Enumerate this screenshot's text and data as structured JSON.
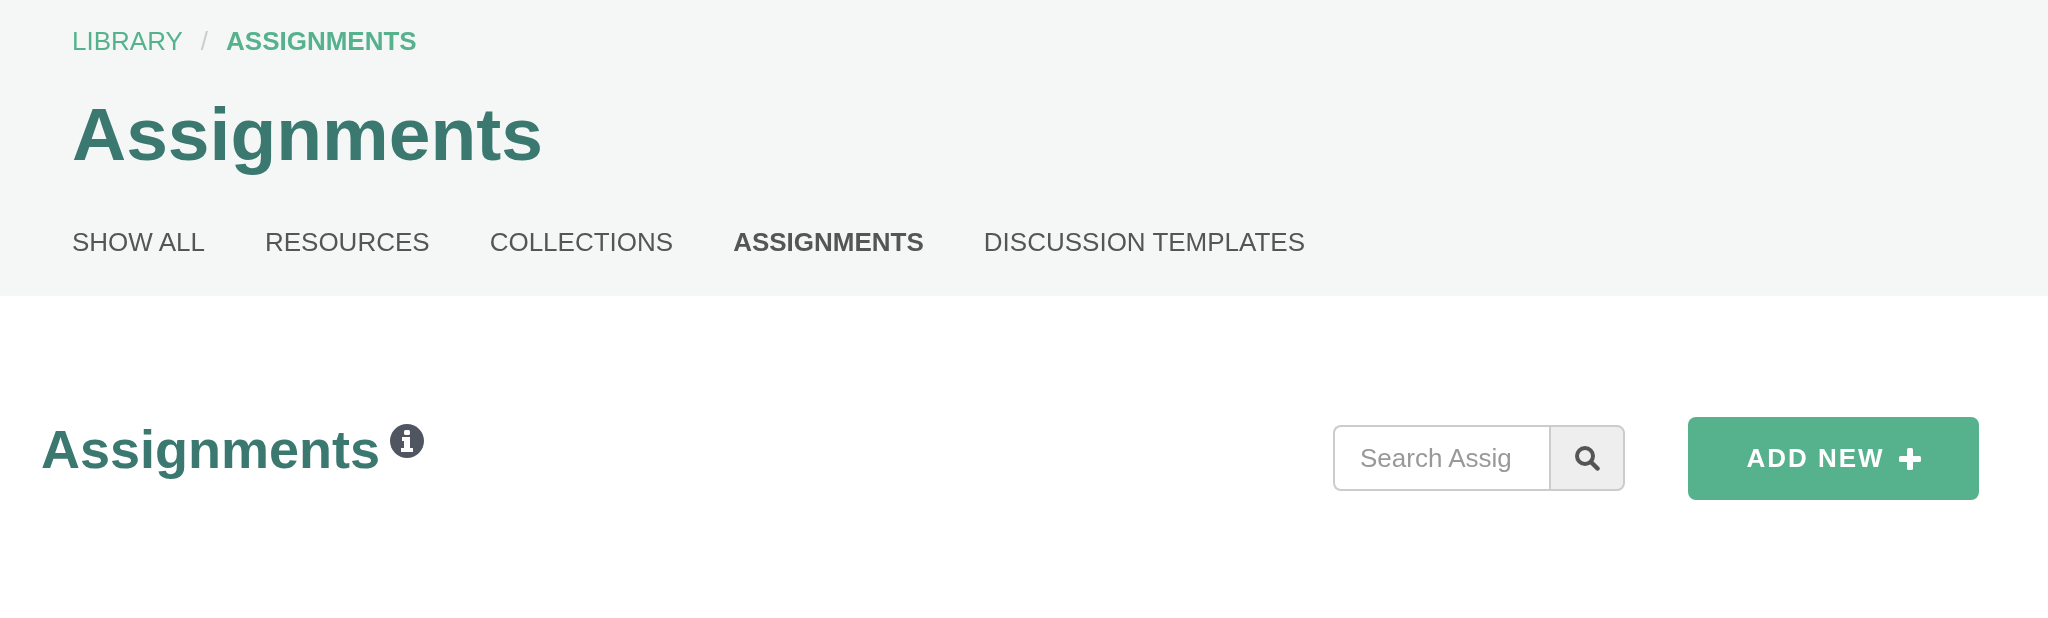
{
  "breadcrumb": [
    {
      "label": "LIBRARY",
      "current": false
    },
    {
      "label": "ASSIGNMENTS",
      "current": true
    }
  ],
  "breadcrumb_separator": "/",
  "page_title": "Assignments",
  "tabs": [
    {
      "label": "SHOW ALL",
      "selected": false
    },
    {
      "label": "RESOURCES",
      "selected": false
    },
    {
      "label": "COLLECTIONS",
      "selected": false
    },
    {
      "label": "ASSIGNMENTS",
      "selected": true
    },
    {
      "label": "DISCUSSION TEMPLATES",
      "selected": false
    }
  ],
  "section": {
    "title": "Assignments",
    "search": {
      "placeholder": "Search Assig"
    },
    "add_button": {
      "label": "ADD NEW"
    }
  }
}
